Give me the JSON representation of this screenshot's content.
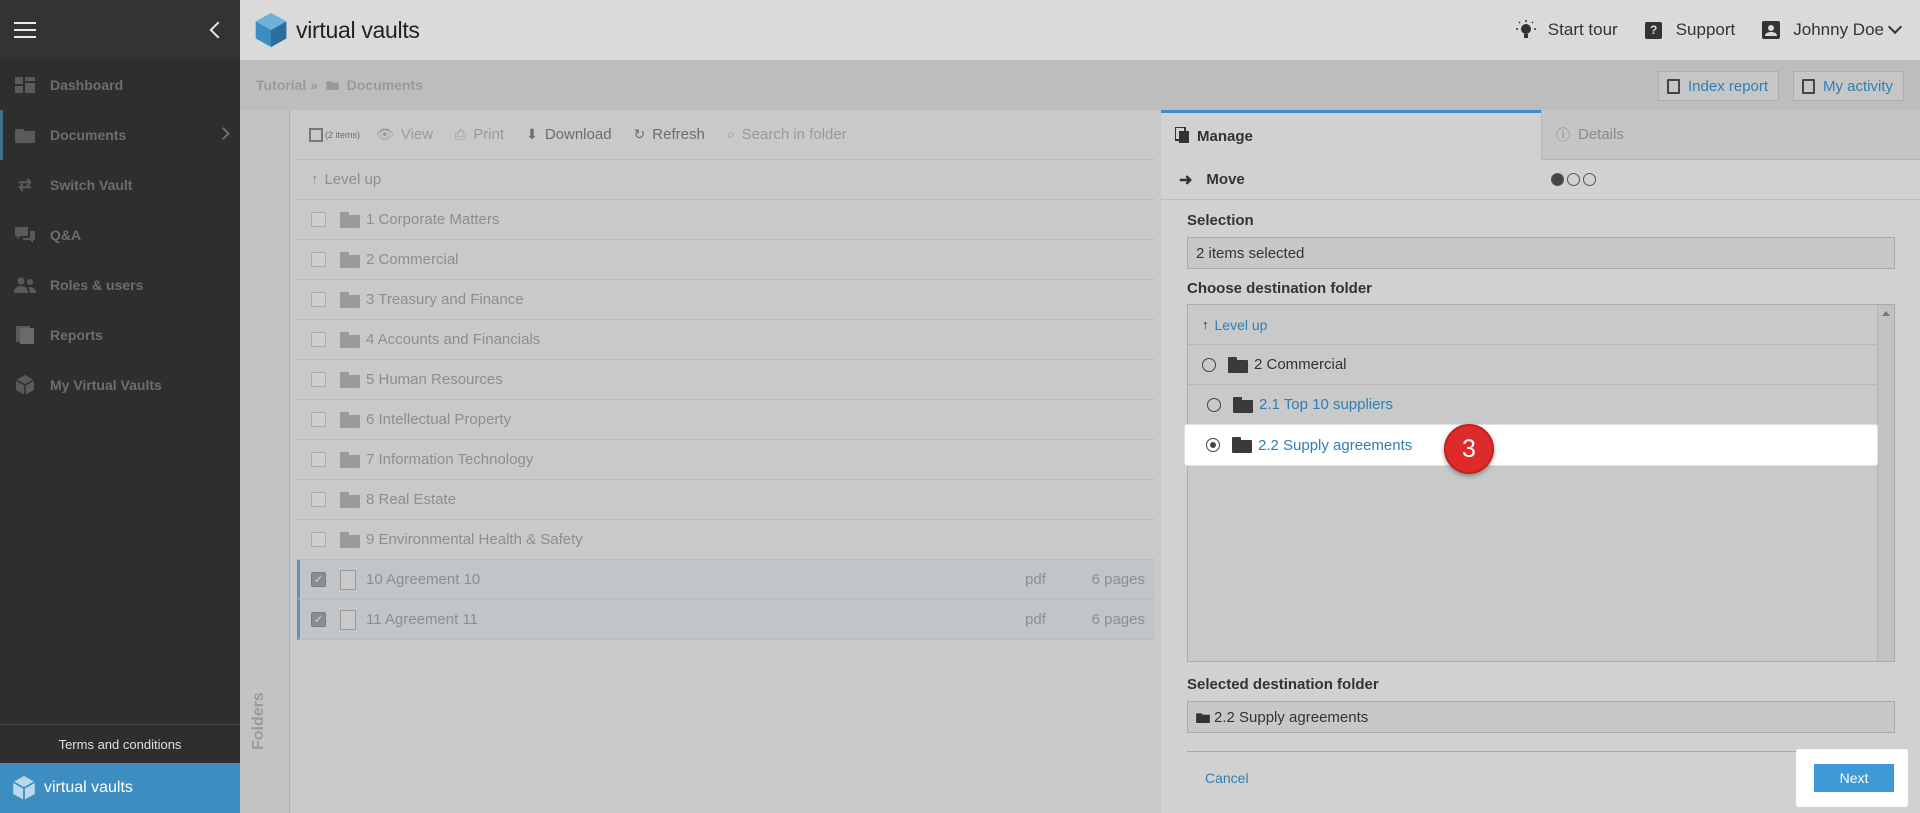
{
  "sidebar": {
    "items": [
      {
        "label": "Dashboard"
      },
      {
        "label": "Documents"
      },
      {
        "label": "Switch Vault"
      },
      {
        "label": "Q&A"
      },
      {
        "label": "Roles & users"
      },
      {
        "label": "Reports"
      },
      {
        "label": "My Virtual Vaults"
      }
    ],
    "terms": "Terms and conditions",
    "brand": "virtual vaults"
  },
  "header": {
    "logo_text": "virtual vaults",
    "start_tour": "Start tour",
    "support": "Support",
    "user_name": "Johnny Doe"
  },
  "subheader": {
    "crumb_root": "Tutorial »",
    "crumb_current": "Documents",
    "index_report": "Index report",
    "my_activity": "My activity"
  },
  "folders_tab": "Folders",
  "toolbar": {
    "selected_count": "(2 items)",
    "view": "View",
    "print": "Print",
    "download": "Download",
    "refresh": "Refresh",
    "search_placeholder": "Search in folder"
  },
  "doclist": {
    "level_up": "Level up",
    "folders": [
      "1 Corporate Matters",
      "2 Commercial",
      "3 Treasury and Finance",
      "4 Accounts and Financials",
      "5 Human Resources",
      "6 Intellectual Property",
      "7 Information Technology",
      "8 Real Estate",
      "9 Environmental Health & Safety"
    ],
    "files": [
      {
        "name": "10 Agreement 10",
        "ext": "pdf",
        "pages": "6 pages"
      },
      {
        "name": "11 Agreement 11",
        "ext": "pdf",
        "pages": "6 pages"
      }
    ]
  },
  "panel": {
    "tab_manage": "Manage",
    "tab_details": "Details",
    "action": "Move",
    "selection_label": "Selection",
    "selection_value": "2 items selected",
    "choose_label": "Choose destination folder",
    "dest_level_up": "Level up",
    "dest_parent": "2 Commercial",
    "dest_child_1": "2.1 Top 10 suppliers",
    "dest_child_2": "2.2 Supply agreements",
    "selected_dest_label": "Selected destination folder",
    "selected_dest_value": "2.2 Supply agreements",
    "cancel": "Cancel",
    "next": "Next"
  },
  "step_badge": "3",
  "colors": {
    "accent": "#3e8dc0",
    "link": "#2f7fb3",
    "badge": "#dd2b2b"
  }
}
